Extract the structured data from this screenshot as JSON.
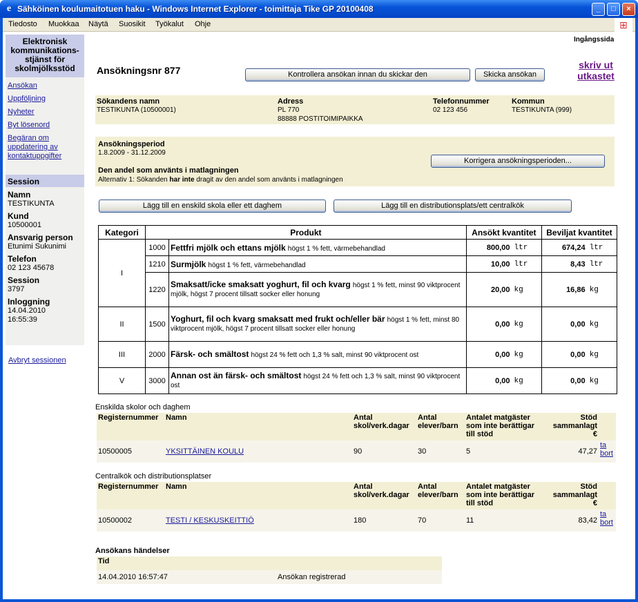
{
  "window": {
    "title": "Sähköinen koulumaitotuen haku - Windows Internet Explorer - toimittaja Tike GP 20100408"
  },
  "menu": [
    "Tiedosto",
    "Muokkaa",
    "Näytä",
    "Suosikit",
    "Työkalut",
    "Ohje"
  ],
  "sidebar": {
    "title": "Elektronisk kommunikations-stjänst för skolmjölksstöd",
    "links": [
      "Ansökan",
      "Uppföljning",
      "Nyheter",
      "Byt lösenord",
      "Begäran om uppdatering av kontaktuppgifter"
    ],
    "session_header": "Session",
    "fields": [
      {
        "label": "Namn",
        "value": "TESTIKUNTA"
      },
      {
        "label": "Kund",
        "value": "10500001"
      },
      {
        "label": "Ansvarig person",
        "value": "Etunimi Sukunimi"
      },
      {
        "label": "Telefon",
        "value": "02 123 45678"
      },
      {
        "label": "Session",
        "value": "3797"
      },
      {
        "label": "Inloggning",
        "value": "14.04.2010 16:55:39"
      }
    ],
    "abort": "Avbryt sessionen"
  },
  "page": {
    "home_link": "Ingångssida",
    "heading": "Ansökningsnr 877",
    "print_link": "skriv ut utkastet",
    "check_button": "Kontrollera ansökan innan du skickar den",
    "send_button": "Skicka ansökan"
  },
  "applicant": {
    "name_label": "Sökandens namn",
    "name": "TESTIKUNTA (10500001)",
    "address_label": "Adress",
    "address1": "PL 770",
    "address2": "88888 POSTITOIMIPAIKKA",
    "phone_label": "Telefonnummer",
    "phone": "02 123 456",
    "municipality_label": "Kommun",
    "municipality": "TESTIKUNTA (999)"
  },
  "period": {
    "label": "Ansökningsperiod",
    "value": "1.8.2009 - 31.12.2009",
    "share_label": "Den andel som använts i matlagningen",
    "share_pre": "Alternativ 1: Sökanden ",
    "share_bold": "har inte",
    "share_post": " dragit av den andel som använts i matlagningen",
    "correct_button": "Korrigera ansökningsperioden..."
  },
  "actions": {
    "add_school": "Lägg till en enskild skola eller ett daghem",
    "add_central": "Lägg till en distributionsplats/ett centralkök"
  },
  "products": {
    "headers": {
      "category": "Kategori",
      "product": "Produkt",
      "applied": "Ansökt kvantitet",
      "granted": "Beviljat kvantitet"
    },
    "rows": [
      {
        "cat": "I",
        "code": "1000",
        "name": "Fettfri mjölk och ettans mjölk",
        "desc": "högst 1 % fett, värmebehandlad",
        "applied": "800,00",
        "granted": "674,24",
        "unit": "ltr"
      },
      {
        "cat": "",
        "code": "1210",
        "name": "Surmjölk",
        "desc": "högst 1 % fett, värmebehandlad",
        "applied": "10,00",
        "granted": "8,43",
        "unit": "ltr"
      },
      {
        "cat": "",
        "code": "1220",
        "name": "Smaksatt/icke smaksatt yoghurt, fil och kvarg",
        "desc": "högst 1 % fett, minst 90 viktprocent mjölk, högst 7 procent tillsatt socker eller honung",
        "applied": "20,00",
        "granted": "16,86",
        "unit": "kg"
      },
      {
        "cat": "II",
        "code": "1500",
        "name": "Yoghurt, fil och kvarg smaksatt med frukt och/eller bär",
        "desc": "högst 1 % fett, minst 80 viktprocent mjölk, högst 7 procent tillsatt socker eller honung",
        "applied": "0,00",
        "granted": "0,00",
        "unit": "kg"
      },
      {
        "cat": "III",
        "code": "2000",
        "name": "Färsk- och smältost",
        "desc": "högst 24 % fett och 1,3 % salt, minst 90 viktprocent ost",
        "applied": "0,00",
        "granted": "0,00",
        "unit": "kg"
      },
      {
        "cat": "V",
        "code": "3000",
        "name": "Annan ost än färsk- och smältost",
        "desc": "högst 24 % fett och 1,3 % salt, minst 90 viktprocent ost",
        "applied": "0,00",
        "granted": "0,00",
        "unit": "kg"
      }
    ]
  },
  "schools": {
    "caption": "Enskilda skolor och daghem",
    "headers": [
      "Registernummer",
      "Namn",
      "Antal skol/verk.dagar",
      "Antal elever/barn",
      "Antalet matgäster som inte berättigar till stöd",
      "Stöd sammanlagt €"
    ],
    "row": {
      "reg": "10500005",
      "name": "YKSITTÄINEN KOULU",
      "days": "90",
      "pupils": "30",
      "guests": "5",
      "sum": "47,27",
      "remove": "ta bort"
    }
  },
  "central": {
    "caption": "Centralkök och distributionsplatser",
    "headers": [
      "Registernummer",
      "Namn",
      "Antal skol/verk.dagar",
      "Antal elever/barn",
      "Antalet matgäster som inte berättigar till stöd",
      "Stöd sammanlagt €"
    ],
    "row": {
      "reg": "10500002",
      "name": "TESTI / KESKUSKEITTIÖ",
      "days": "180",
      "pupils": "70",
      "guests": "11",
      "sum": "83,42",
      "remove": "ta bort"
    }
  },
  "events": {
    "caption": "Ansökans händelser",
    "header": "Tid",
    "time": "14.04.2010 16:57:47",
    "text": "Ansökan registrerad"
  }
}
